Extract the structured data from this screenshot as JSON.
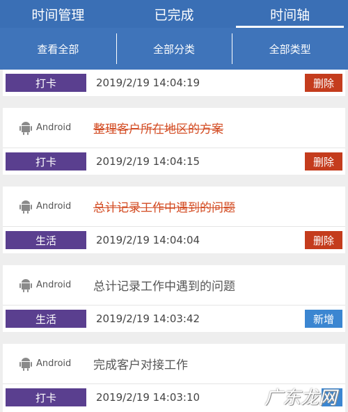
{
  "top_tabs": [
    "时间管理",
    "已完成",
    "时间轴"
  ],
  "filters": [
    "查看全部",
    "全部分类",
    "全部类型"
  ],
  "entries": [
    {
      "source": "",
      "title": "",
      "category": "打卡",
      "time": "2019/2/19 14:04:19",
      "action": "删除",
      "action_type": "delete",
      "done": true
    },
    {
      "source": "Android",
      "title": "整理客户所在地区的方案",
      "category": "打卡",
      "time": "2019/2/19 14:04:15",
      "action": "删除",
      "action_type": "delete",
      "done": true
    },
    {
      "source": "Android",
      "title": "总计记录工作中遇到的问题",
      "category": "生活",
      "time": "2019/2/19 14:04:04",
      "action": "删除",
      "action_type": "delete",
      "done": true
    },
    {
      "source": "Android",
      "title": "总计记录工作中遇到的问题",
      "category": "生活",
      "time": "2019/2/19 14:03:42",
      "action": "新增",
      "action_type": "add",
      "done": false
    },
    {
      "source": "Android",
      "title": "完成客户对接工作",
      "category": "打卡",
      "time": "2019/2/19 14:03:10",
      "action": "",
      "action_type": "add",
      "done": false
    }
  ],
  "watermark": "广东龙网",
  "colors": {
    "header": "#3a6fb5",
    "category": "#5a3f8f",
    "delete": "#c43c1d",
    "add": "#3b86d1",
    "done_title": "#d34b22"
  }
}
